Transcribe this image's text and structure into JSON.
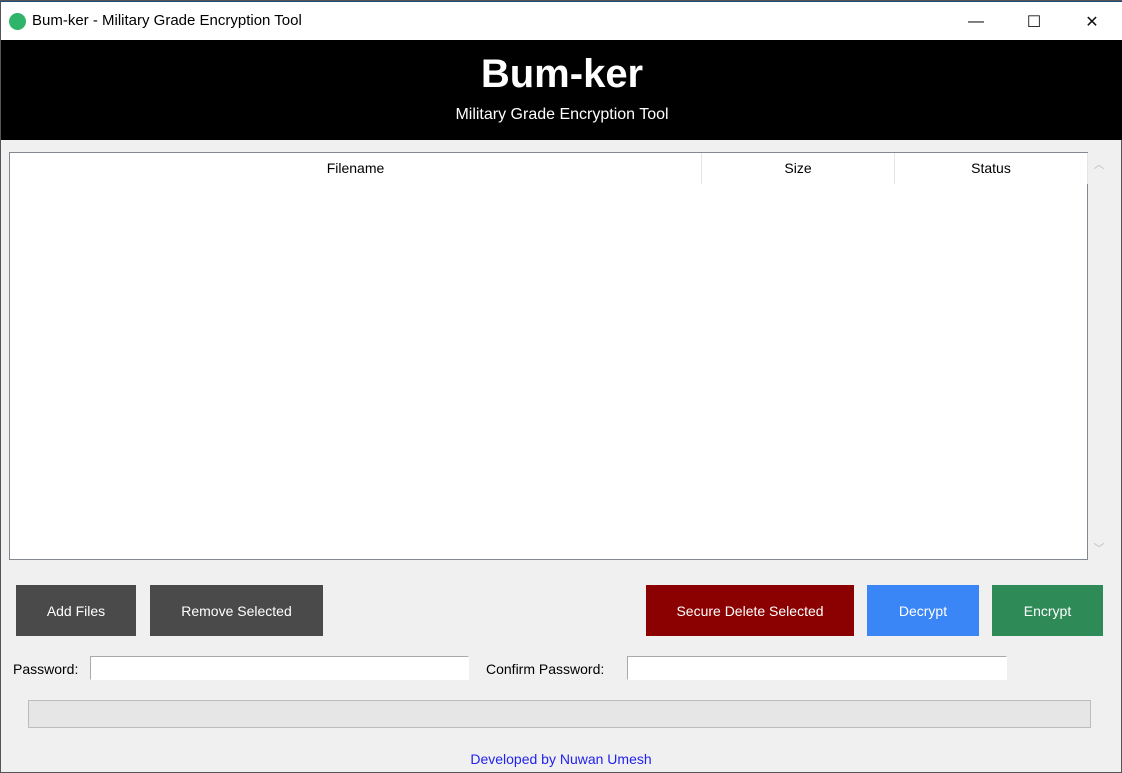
{
  "window": {
    "title": "Bum-ker - Military Grade Encryption Tool",
    "minimize": "—",
    "maximize": "☐",
    "close": "✕"
  },
  "header": {
    "title": "Bum-ker",
    "subtitle": "Military Grade Encryption Tool"
  },
  "table": {
    "columns": [
      "Filename",
      "Size",
      "Status"
    ],
    "rows": []
  },
  "buttons": {
    "add": "Add Files",
    "remove": "Remove Selected",
    "secure_delete": "Secure Delete Selected",
    "decrypt": "Decrypt",
    "encrypt": "Encrypt"
  },
  "colors": {
    "dark_button": "#4a4a4a",
    "secure_delete": "#8b0000",
    "decrypt": "#3b86f7",
    "encrypt": "#2e8b57"
  },
  "form": {
    "password_label": "Password:",
    "password_value": "",
    "confirm_label": "Confirm Password:",
    "confirm_value": ""
  },
  "progress": {
    "percent": 0
  },
  "footer": {
    "text": "Developed by Nuwan Umesh"
  }
}
